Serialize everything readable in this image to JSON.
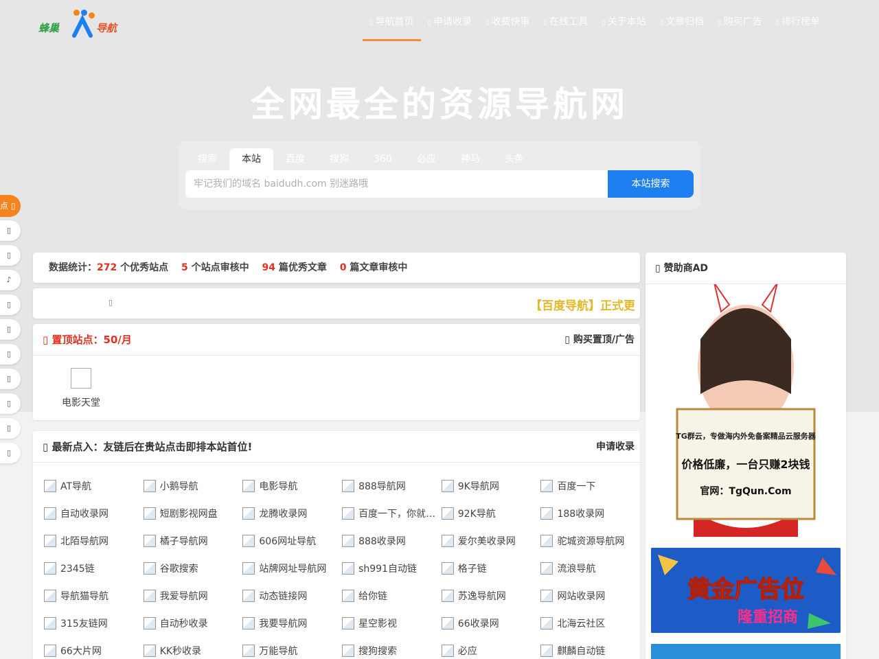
{
  "logo": {
    "part1": "蜂巢",
    "part2": "导航"
  },
  "nav": [
    {
      "label": "导航首页",
      "icon": "home-icon",
      "active": true
    },
    {
      "label": "申请收录",
      "icon": "apply-icon"
    },
    {
      "label": "收费快审",
      "icon": "fast-review-icon"
    },
    {
      "label": "在线工具",
      "icon": "tools-icon"
    },
    {
      "label": "关于本站",
      "icon": "about-icon"
    },
    {
      "label": "文章归档",
      "icon": "archive-icon"
    },
    {
      "label": "购买广告",
      "icon": "ad-icon"
    },
    {
      "label": "排行榜单",
      "icon": "ranking-icon"
    }
  ],
  "hero": {
    "title": "全网最全的资源导航网"
  },
  "search": {
    "tabs": [
      "搜索",
      "本站",
      "百度",
      "搜狗",
      "360",
      "必应",
      "神马",
      "头条"
    ],
    "active_tab": "本站",
    "placeholder": "牢记我们的域名 baidudh.com 别迷路哦",
    "button": "本站搜索"
  },
  "stats": {
    "prefix": "数据统计：",
    "sites": "272",
    "sites_label": "个优秀站点",
    "pending_sites": "5",
    "pending_sites_label": "个站点审核中",
    "articles": "94",
    "articles_label": "篇优秀文章",
    "pending_articles": "0",
    "pending_articles_label": "篇文章审核中"
  },
  "ticker": {
    "text": "【百度导航】正式更"
  },
  "top_sites": {
    "title": "置顶站点：50/月",
    "link": "购买置顶/广告",
    "items": [
      {
        "name": "电影天堂"
      }
    ]
  },
  "latest": {
    "title": "最新点入：友链后在贵站点击即排本站首位!",
    "link": "申请收录",
    "items": [
      "AT导航",
      "小鹅导航",
      "电影导航",
      "888导航网",
      "9K导航网",
      "百度一下",
      "自动收录网",
      "短剧影视网盘",
      "龙腾收录网",
      "百度一下，你就知道",
      "92K导航",
      "188收录网",
      "北陌导航网",
      "橘子导航网",
      "606网址导航",
      "888收录网",
      "爱尔美收录网",
      "驼城资源导航网",
      "2345链",
      "谷歌搜索",
      "站牌网址导航网",
      "sh991自动链",
      "格子链",
      "流浪导航",
      "导航猫导航",
      "我爱导航网",
      "动态链接网",
      "给你链",
      "苏逸导航网",
      "网站收录网",
      "315友链网",
      "自动秒收录",
      "我要导航网",
      "星空影视",
      "66收录网",
      "北海云社区",
      "66大片网",
      "KK秒收录",
      "万能导航",
      "搜狗搜索",
      "必应",
      "麒麟自动链"
    ]
  },
  "sponsor": {
    "title": "赞助商AD",
    "ad1": {
      "line1": "TG群云，专做海内外免备案精品云服务器",
      "line2": "价格低廉，一台只赚2块钱",
      "line3": "官网：TgQun.Com"
    },
    "ad2": {
      "big": "黄金广告位",
      "sub": "隆重招商"
    }
  },
  "float_bar": {
    "top_label": "点"
  },
  "colors": {
    "accent": "#f5841f",
    "primary": "#1e80f0",
    "red": "#e0301e"
  }
}
